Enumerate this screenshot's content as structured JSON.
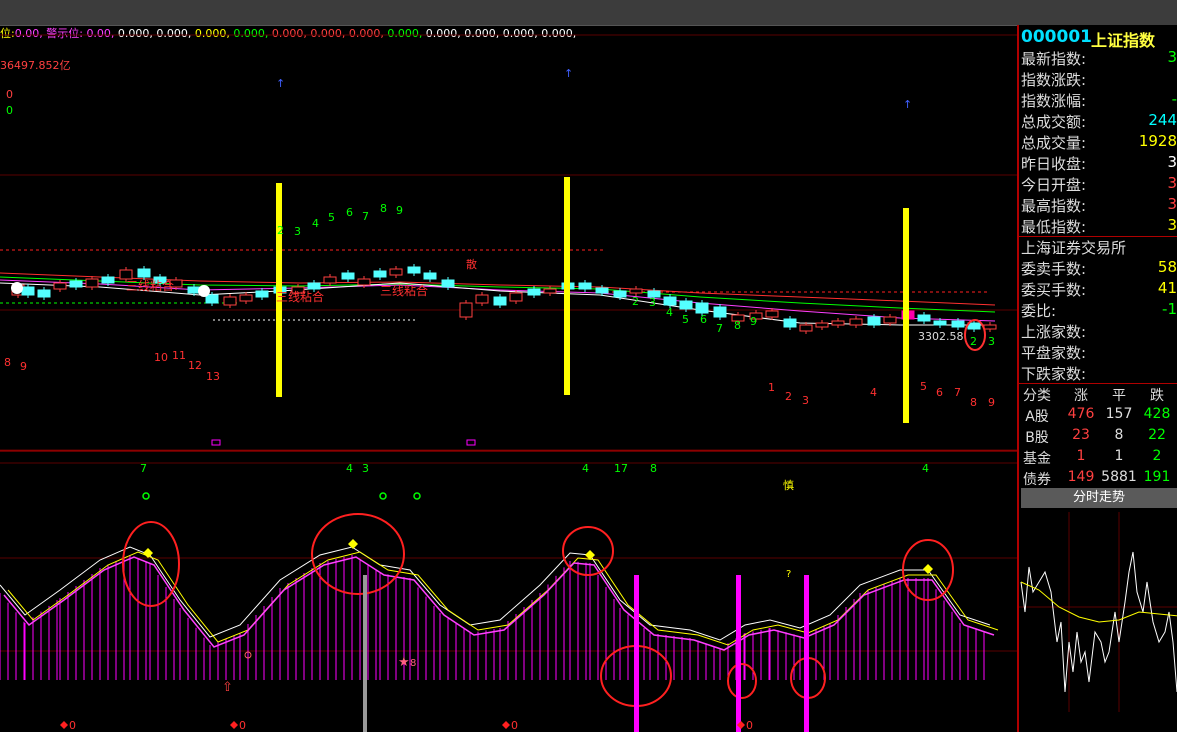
{
  "legend": {
    "pos_label": "位:",
    "pos_value": "0.00,",
    "warn_label": "警示位:",
    "values": [
      "0.00,",
      "0.000,",
      "0.000,",
      "0.000,",
      "0.000,",
      "0.000,",
      "0.000,",
      "0.000,",
      "0.000,",
      "0.000,",
      "0.000,",
      "0.000,",
      "0.000,"
    ],
    "value_colors": [
      "#ff40ff",
      "#ffffff",
      "#ffffff",
      "#ffff00",
      "#00ff00",
      "#ff4040",
      "#ff4040",
      "#ff4040",
      "#00ff00",
      "#ffffff",
      "#ffffff",
      "#ffffff",
      "#ffffff"
    ]
  },
  "volume_text": "36497.852亿",
  "zero_labels": [
    "0",
    "0"
  ],
  "candle_labels": {
    "san_xian_1": "三线粘合",
    "san_xian_2": "三线粘合",
    "san_xian_3": "三线粘合",
    "san_small": "散",
    "price": "3302.58"
  },
  "top_numbers": [
    "2",
    "3",
    "4",
    "5",
    "6",
    "7",
    "8",
    "9"
  ],
  "red_left_numbers": [
    "8",
    "9",
    "10",
    "11",
    "12",
    "13"
  ],
  "green_mid_numbers": [
    "2",
    "3",
    "4",
    "5",
    "6",
    "7",
    "8",
    "9"
  ],
  "red_right_numbers": [
    "1",
    "2",
    "3",
    "4",
    "5",
    "6",
    "7",
    "8",
    "9"
  ],
  "green_right_numbers": [
    "2",
    "3"
  ],
  "osc_top_numbers": [
    "7",
    "4",
    "3",
    "4",
    "17",
    "8",
    "4"
  ],
  "osc_tag": "慎",
  "osc_question": "?",
  "osc_bottom": [
    "0",
    "0",
    "0",
    "0"
  ],
  "star_label": "8",
  "sidebar": {
    "code": "000001",
    "name": "上证指数",
    "rows": [
      {
        "label": "最新指数:",
        "value": "3",
        "color": "#00ff00"
      },
      {
        "label": "指数涨跌:",
        "value": "",
        "color": "#00ff00"
      },
      {
        "label": "指数涨幅:",
        "value": "-",
        "color": "#00ff00"
      },
      {
        "label": "总成交额:",
        "value": "244",
        "color": "#00ffff"
      },
      {
        "label": "总成交量:",
        "value": "1928",
        "color": "#ffff00"
      },
      {
        "label": "昨日收盘:",
        "value": "3",
        "color": "#ffffff"
      },
      {
        "label": "今日开盘:",
        "value": "3",
        "color": "#ff4040"
      },
      {
        "label": "最高指数:",
        "value": "3",
        "color": "#ff4040"
      },
      {
        "label": "最低指数:",
        "value": "3",
        "color": "#ffff00"
      },
      {
        "label": "上海证券交易所",
        "value": "",
        "color": "#ffffff"
      },
      {
        "label": "委卖手数:",
        "value": "58",
        "color": "#ffff00"
      },
      {
        "label": "委买手数:",
        "value": "41",
        "color": "#ffff00"
      },
      {
        "label": "  委比:",
        "value": "-1",
        "color": "#00ff00"
      },
      {
        "label": "上涨家数:",
        "value": "",
        "color": "#ffffff"
      },
      {
        "label": "平盘家数:",
        "value": "",
        "color": "#ffffff"
      },
      {
        "label": "下跌家数:",
        "value": "",
        "color": "#ffffff"
      }
    ],
    "table_headers": [
      "分类",
      "涨",
      "平",
      "跌"
    ],
    "table_rows": [
      {
        "name": "A股",
        "up": "476",
        "flat": "157",
        "down": "428"
      },
      {
        "name": "B股",
        "up": "23",
        "flat": "8",
        "down": "22"
      },
      {
        "name": "基金",
        "up": "1",
        "flat": "1",
        "down": "2"
      },
      {
        "name": "债券",
        "up": "149",
        "flat": "5881",
        "down": "191"
      }
    ],
    "tab": "分时走势"
  },
  "colors": {
    "up": "#ff4040",
    "down": "#54ffff",
    "accent_yellow": "#ffff00",
    "accent_magenta": "#ff00ff",
    "grid_red": "#8b0000"
  }
}
